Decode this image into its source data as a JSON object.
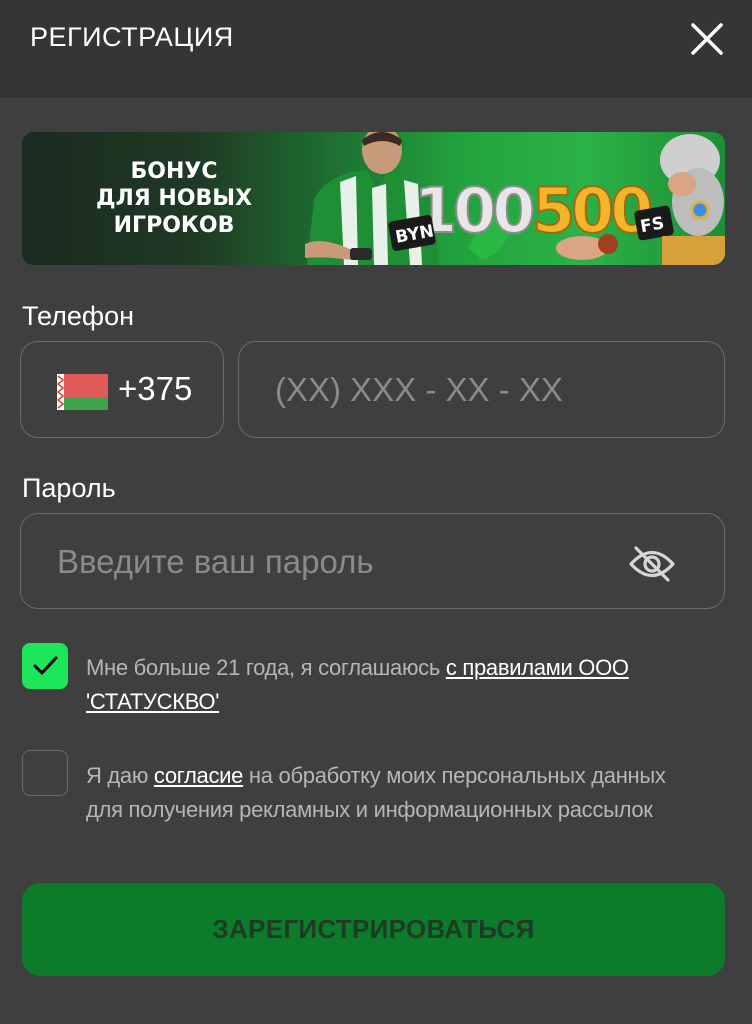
{
  "header": {
    "title": "РЕГИСТРАЦИЯ",
    "close_icon": "close-icon"
  },
  "banner": {
    "line1": "БОНУС",
    "line2": "ДЛЯ НОВЫХ",
    "line3": "ИГРОКОВ",
    "amount1": "100",
    "currency": "BYN",
    "amount2": "500",
    "spins": "FS"
  },
  "phone": {
    "label": "Телефон",
    "country_code": "+375",
    "flag_icon": "belarus-flag-icon",
    "placeholder": "(XX) XXX - XX - XX"
  },
  "password": {
    "label": "Пароль",
    "placeholder": "Введите ваш пароль",
    "visibility_icon": "eye-off-icon"
  },
  "agreements": {
    "age": {
      "checked": true,
      "text": "Мне больше 21 года, я соглашаюсь ",
      "link": "с правилами ООО 'СТАТУСКВО'"
    },
    "marketing": {
      "checked": false,
      "text_before": "Я даю ",
      "link": "согласие",
      "text_after": " на обработку моих персональных данных для получения рекламных и информационных рассылок"
    }
  },
  "submit": {
    "label": "ЗАРЕГИСТРИРОВАТЬСЯ"
  },
  "colors": {
    "background": "#3f3f3f",
    "header": "#353535",
    "accent_green": "#1ee65a",
    "button_green": "#0c7c2a",
    "border": "#6a6a6a"
  }
}
